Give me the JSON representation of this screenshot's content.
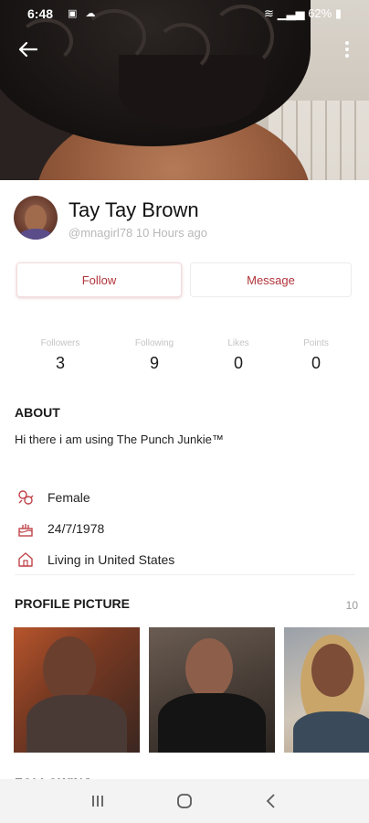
{
  "status_bar": {
    "time": "6:48",
    "battery": "62%"
  },
  "profile": {
    "name": "Tay Tay Brown",
    "handle_time": "@mnagirl78 10 Hours ago"
  },
  "actions": {
    "follow_label": "Follow",
    "message_label": "Message"
  },
  "stats": [
    {
      "label": "Followers",
      "value": "3"
    },
    {
      "label": "Following",
      "value": "9"
    },
    {
      "label": "Likes",
      "value": "0"
    },
    {
      "label": "Points",
      "value": "0"
    }
  ],
  "about": {
    "title": "ABOUT",
    "text": "Hi there i am using The Punch Junkie™"
  },
  "info": [
    {
      "icon": "gender-icon",
      "text": "Female"
    },
    {
      "icon": "birthday-cake-icon",
      "text": "24/7/1978"
    },
    {
      "icon": "home-icon",
      "text": "Living in United States"
    }
  ],
  "profile_pictures": {
    "title": "PROFILE PICTURE",
    "count": "10"
  },
  "next_section": {
    "title": "FOLLOWING"
  },
  "colors": {
    "accent": "#b0333a",
    "icon": "#c0444a"
  }
}
